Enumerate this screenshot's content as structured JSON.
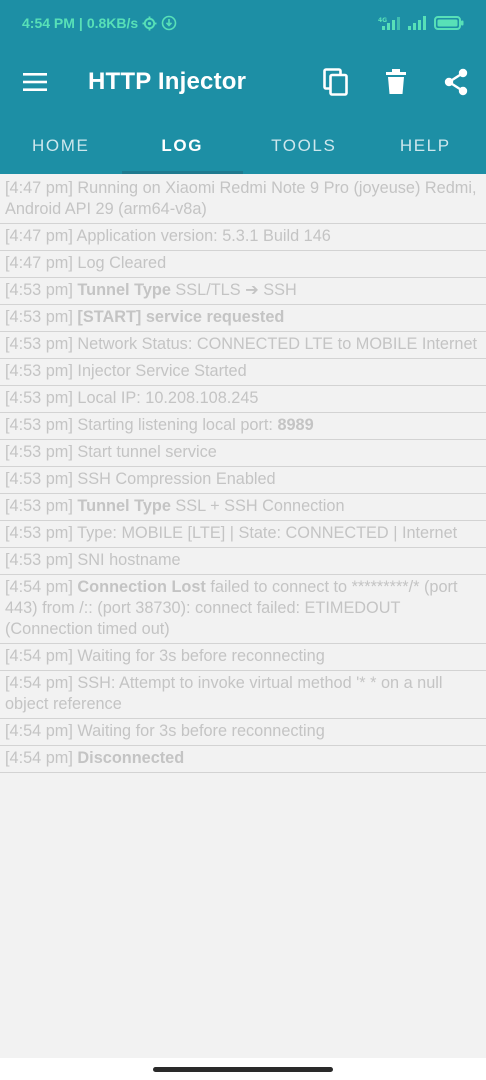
{
  "status_bar": {
    "time": "4:54 PM",
    "sep": "|",
    "speed": "0.8KB/s",
    "network_label": "4G"
  },
  "app_bar": {
    "title": "HTTP Injector",
    "icons": [
      "menu-icon",
      "copy-icon",
      "delete-icon",
      "share-icon"
    ]
  },
  "tabs": [
    {
      "label": "HOME",
      "active": false
    },
    {
      "label": "LOG",
      "active": true
    },
    {
      "label": "TOOLS",
      "active": false
    },
    {
      "label": "HELP",
      "active": false
    }
  ],
  "log": [
    {
      "time": "[4:47 pm]",
      "bold": "",
      "text": "Running on Xiaomi Redmi Note 9 Pro (joyeuse) Redmi, Android API 29 (arm64-v8a)"
    },
    {
      "time": "[4:47 pm]",
      "bold": "",
      "text": "Application version: 5.3.1 Build 146"
    },
    {
      "time": "[4:47 pm]",
      "bold": "",
      "text": "Log Cleared"
    },
    {
      "time": "[4:53 pm]",
      "bold": "Tunnel Type",
      "text": "SSL/TLS ➔ SSH"
    },
    {
      "time": "[4:53 pm]",
      "bold": "[START] service requested",
      "text": ""
    },
    {
      "time": "[4:53 pm]",
      "bold": "",
      "text": "Network Status: CONNECTED LTE to MOBILE Internet"
    },
    {
      "time": "[4:53 pm]",
      "bold": "",
      "text": "Injector Service Started"
    },
    {
      "time": "[4:53 pm]",
      "bold": "",
      "text": "Local IP: 10.208.108.245"
    },
    {
      "time": "[4:53 pm]",
      "bold": "",
      "text": "Starting listening local port:",
      "bold_after": "8989"
    },
    {
      "time": "[4:53 pm]",
      "bold": "",
      "text": "Start tunnel service"
    },
    {
      "time": "[4:53 pm]",
      "bold": "",
      "text": "SSH Compression Enabled"
    },
    {
      "time": "[4:53 pm]",
      "bold": "Tunnel Type",
      "text": "SSL + SSH Connection"
    },
    {
      "time": "[4:53 pm]",
      "bold": "",
      "text": "Type: MOBILE [LTE] | State: CONNECTED | Internet"
    },
    {
      "time": "[4:53 pm]",
      "bold": "",
      "text": "SNI hostname"
    },
    {
      "time": "[4:54 pm]",
      "bold": "Connection Lost",
      "text": "failed to connect to *********/* (port 443) from /:: (port 38730): connect failed: ETIMEDOUT (Connection timed out)"
    },
    {
      "time": "[4:54 pm]",
      "bold": "",
      "text": "Waiting for 3s before reconnecting"
    },
    {
      "time": "[4:54 pm]",
      "bold": "",
      "text": "SSH: Attempt to invoke virtual method '* * on a null object reference"
    },
    {
      "time": "[4:54 pm]",
      "bold": "",
      "text": "Waiting for 3s before reconnecting"
    },
    {
      "time": "[4:54 pm]",
      "bold": "Disconnected",
      "text": ""
    }
  ],
  "colors": {
    "primary": "#1d8fa5",
    "status_text": "#58e0b7",
    "log_text": "#c4c4c4",
    "background": "#f2f2f2"
  }
}
